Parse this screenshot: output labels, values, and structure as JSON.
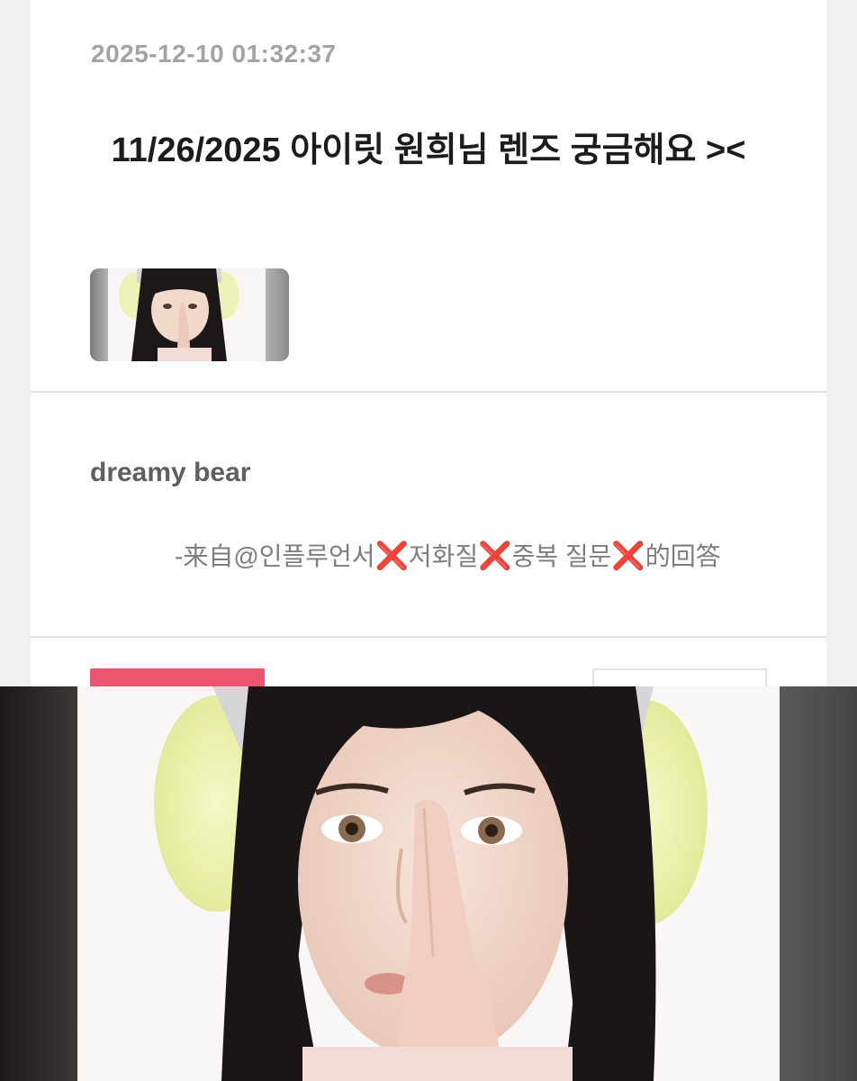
{
  "post": {
    "timestamp": "2025-12-10 01:32:37",
    "title": "11/26/2025 아이릿 원희님 렌즈 궁금해요 ><"
  },
  "answer": {
    "text": "dreamy bear",
    "source_prefix": "-来自@인플루언서",
    "source_part2": "저화질",
    "source_part3": "중복 질문",
    "source_suffix": "的回答",
    "x_glyph": "❌"
  },
  "colors": {
    "accent_pink": "#ea5470",
    "x_red": "#e4202a"
  }
}
